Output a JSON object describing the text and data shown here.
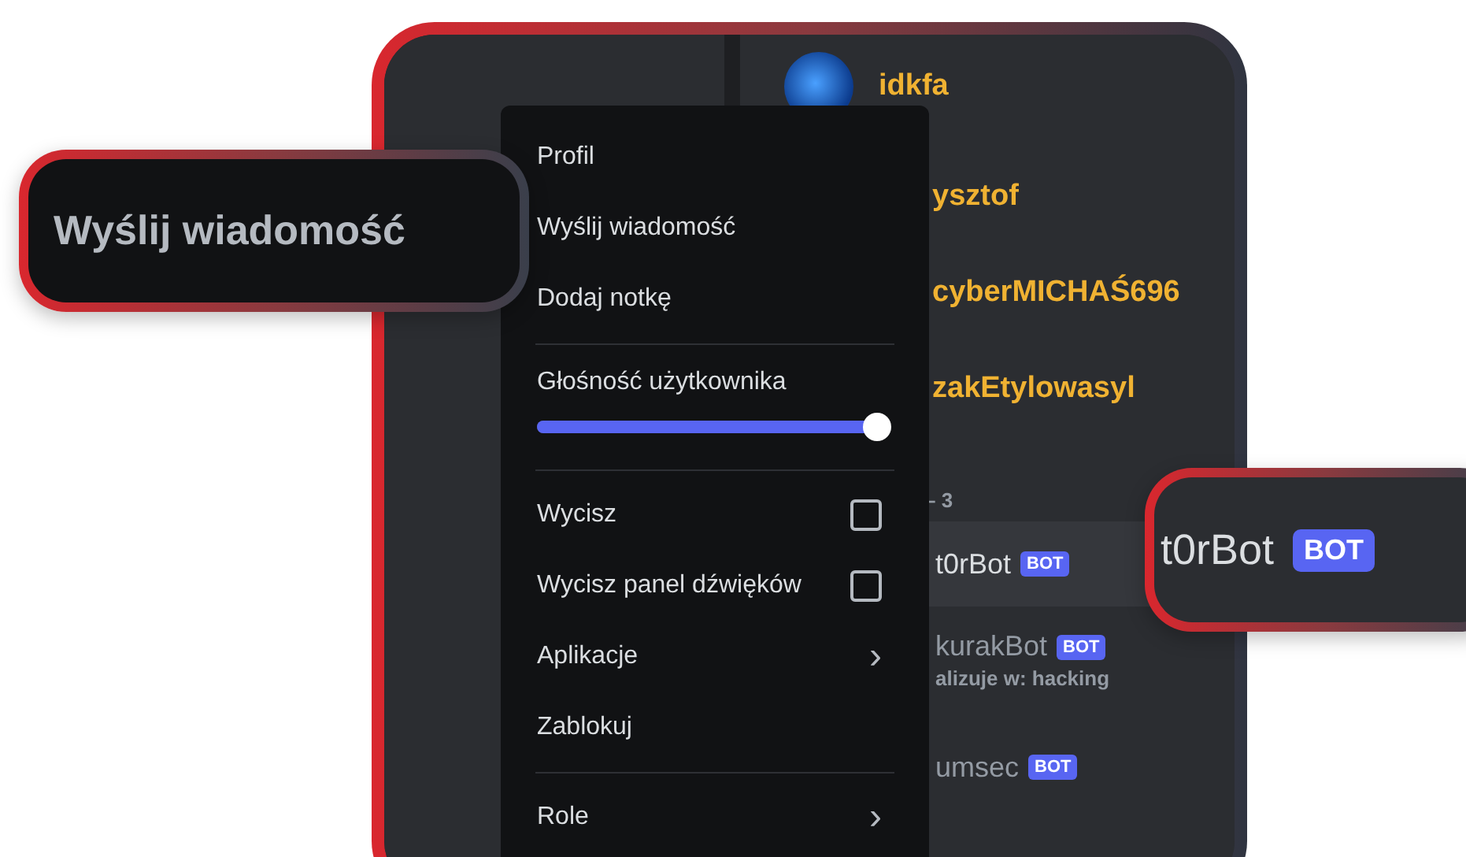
{
  "members": [
    {
      "kind": "avatar",
      "name": "idkfa"
    },
    {
      "kind": "clipped",
      "name": "ysztof"
    },
    {
      "kind": "clipped",
      "name": "cyberMICHAŚ696"
    },
    {
      "kind": "clipped",
      "name": "zakEtylowasyl"
    },
    {
      "kind": "header",
      "name": "– 3"
    },
    {
      "kind": "bot",
      "name": "t0rBot",
      "badge": "BOT",
      "selected": true
    },
    {
      "kind": "bot",
      "name": "kurakBot",
      "badge": "BOT",
      "status": "alizuje w: hacking",
      "selected": false
    },
    {
      "kind": "bot",
      "name": "umsec",
      "badge": "BOT",
      "selected": false
    }
  ],
  "menu": {
    "groups": [
      [
        {
          "kind": "item",
          "label": "Profil"
        },
        {
          "kind": "item",
          "label": "Wyślij wiadomość"
        },
        {
          "kind": "item",
          "label": "Dodaj notkę"
        }
      ],
      [
        {
          "kind": "slider",
          "label": "Głośność użytkownika",
          "level": 1.0
        }
      ],
      [
        {
          "kind": "checkbox",
          "label": "Wycisz",
          "checked": false
        },
        {
          "kind": "checkbox",
          "label": "Wycisz panel dźwięków",
          "checked": false
        },
        {
          "kind": "submenu",
          "label": "Aplikacje",
          "arrow": "›"
        },
        {
          "kind": "item",
          "label": "Zablokuj"
        }
      ],
      [
        {
          "kind": "submenu",
          "label": "Role",
          "arrow": "›"
        }
      ]
    ]
  },
  "callouts": [
    {
      "kind": "text",
      "text": "Wyślij wiadomość"
    },
    {
      "kind": "bot",
      "text": "t0rBot",
      "badge": "BOT"
    }
  ]
}
